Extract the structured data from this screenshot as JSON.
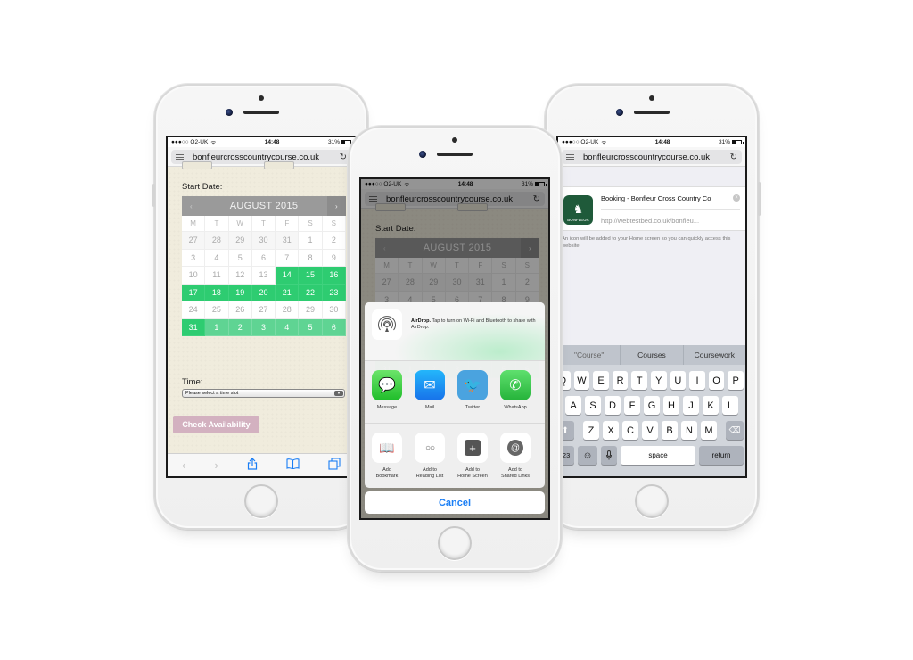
{
  "status_bar": {
    "carrier": "●●●○○ O2-UK",
    "wifi_icon": "wifi-icon",
    "time": "14:48",
    "battery": "31%"
  },
  "browser": {
    "url": "bonfleurcrosscountrycourse.co.uk",
    "menu_icon": "hamburger-icon",
    "reload_icon": "reload-icon"
  },
  "booking_page": {
    "start_date_label": "Start Date:",
    "calendar": {
      "month_title": "AUGUST 2015",
      "prev_icon": "‹",
      "next_icon": "›",
      "weekdays": [
        "M",
        "T",
        "W",
        "T",
        "F",
        "S",
        "S"
      ],
      "weeks": [
        [
          {
            "d": "27",
            "s": "other"
          },
          {
            "d": "28",
            "s": "other"
          },
          {
            "d": "29",
            "s": "other"
          },
          {
            "d": "30",
            "s": "other"
          },
          {
            "d": "31",
            "s": "other"
          },
          {
            "d": "1",
            "s": ""
          },
          {
            "d": "2",
            "s": ""
          }
        ],
        [
          {
            "d": "3",
            "s": ""
          },
          {
            "d": "4",
            "s": ""
          },
          {
            "d": "5",
            "s": ""
          },
          {
            "d": "6",
            "s": ""
          },
          {
            "d": "7",
            "s": ""
          },
          {
            "d": "8",
            "s": ""
          },
          {
            "d": "9",
            "s": ""
          }
        ],
        [
          {
            "d": "10",
            "s": ""
          },
          {
            "d": "11",
            "s": ""
          },
          {
            "d": "12",
            "s": ""
          },
          {
            "d": "13",
            "s": ""
          },
          {
            "d": "14",
            "s": "sel"
          },
          {
            "d": "15",
            "s": "sel"
          },
          {
            "d": "16",
            "s": "sel"
          }
        ],
        [
          {
            "d": "17",
            "s": "sel"
          },
          {
            "d": "18",
            "s": "sel"
          },
          {
            "d": "19",
            "s": "sel"
          },
          {
            "d": "20",
            "s": "sel"
          },
          {
            "d": "21",
            "s": "sel"
          },
          {
            "d": "22",
            "s": "sel"
          },
          {
            "d": "23",
            "s": "sel"
          }
        ],
        [
          {
            "d": "24",
            "s": ""
          },
          {
            "d": "25",
            "s": ""
          },
          {
            "d": "26",
            "s": ""
          },
          {
            "d": "27",
            "s": ""
          },
          {
            "d": "28",
            "s": ""
          },
          {
            "d": "29",
            "s": ""
          },
          {
            "d": "30",
            "s": ""
          }
        ],
        [
          {
            "d": "31",
            "s": "sel"
          },
          {
            "d": "1",
            "s": "sel2"
          },
          {
            "d": "2",
            "s": "sel2"
          },
          {
            "d": "3",
            "s": "sel2"
          },
          {
            "d": "4",
            "s": "sel2"
          },
          {
            "d": "5",
            "s": "sel2"
          },
          {
            "d": "6",
            "s": "sel2"
          }
        ]
      ]
    },
    "time_label": "Time:",
    "time_select_value": "Please select a time slot",
    "check_button": "Check Availability"
  },
  "safari_toolbar": {
    "back": "‹",
    "forward": "›",
    "share": "⇪",
    "bookmarks": "📖",
    "tabs": "❐"
  },
  "share_sheet": {
    "airdrop_title": "AirDrop.",
    "airdrop_text": "Tap to turn on Wi-Fi and Bluetooth to share with AirDrop.",
    "apps": [
      {
        "label": "Message",
        "icon": "message-icon",
        "glyph": "💬"
      },
      {
        "label": "Mail",
        "icon": "mail-icon",
        "glyph": "✉"
      },
      {
        "label": "Twitter",
        "icon": "twitter-icon",
        "glyph": "🐦"
      },
      {
        "label": "WhatsApp",
        "icon": "whatsapp-icon",
        "glyph": "✆"
      }
    ],
    "actions": [
      {
        "label": "Add\nBookmark",
        "l1": "Add",
        "l2": "Bookmark",
        "icon": "bookmark-icon",
        "glyph": "📖"
      },
      {
        "label": "Add to\nReading List",
        "l1": "Add to",
        "l2": "Reading List",
        "icon": "glasses-icon",
        "glyph": "○○"
      },
      {
        "label": "Add to\nHome Screen",
        "l1": "Add to",
        "l2": "Home Screen",
        "icon": "plus-icon",
        "glyph": "+"
      },
      {
        "label": "Add to\nShared Links",
        "l1": "Add to",
        "l2": "Shared Links",
        "icon": "at-icon",
        "glyph": "@"
      }
    ],
    "cancel": "Cancel"
  },
  "add_to_home": {
    "title_value": "Booking - Bonfleur Cross Country Co",
    "url_value": "http://webtestbed.co.uk/bonfleu...",
    "icon_label": "BONFLEUR",
    "note": "An icon will be added to your Home screen so you can quickly access this website."
  },
  "keyboard": {
    "suggestions": [
      "\"Course\"",
      "Courses",
      "Coursework"
    ],
    "row1": [
      "Q",
      "W",
      "E",
      "R",
      "T",
      "Y",
      "U",
      "I",
      "O",
      "P"
    ],
    "row2": [
      "A",
      "S",
      "D",
      "F",
      "G",
      "H",
      "J",
      "K",
      "L"
    ],
    "row3": [
      "Z",
      "X",
      "C",
      "V",
      "B",
      "N",
      "M"
    ],
    "shift": "⬆",
    "delete": "⌫",
    "numbers": "123",
    "emoji": "☺",
    "mic": "🎤",
    "space": "space",
    "return": "return"
  }
}
